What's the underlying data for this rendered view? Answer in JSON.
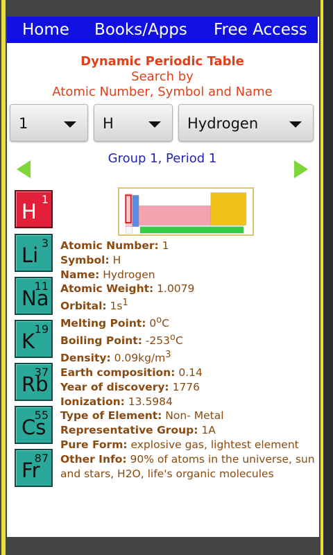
{
  "nav": {
    "home": "Home",
    "books": "Books/Apps",
    "free": "Free Access"
  },
  "header": {
    "title": "Dynamic Periodic Table",
    "line2": "Search by",
    "line3": "Atomic Number, Symbol and Name"
  },
  "selectors": {
    "number": "1",
    "symbol": "H",
    "name": "Hydrogen"
  },
  "group_period": "Group 1, Period 1",
  "tiles": [
    {
      "symbol": "H",
      "number": "1",
      "selected": true
    },
    {
      "symbol": "Li",
      "number": "3"
    },
    {
      "symbol": "Na",
      "number": "11"
    },
    {
      "symbol": "K",
      "number": "19"
    },
    {
      "symbol": "Rb",
      "number": "37"
    },
    {
      "symbol": "Cs",
      "number": "55"
    },
    {
      "symbol": "Fr",
      "number": "87"
    }
  ],
  "details": {
    "atomic_number": {
      "label": "Atomic Number:",
      "value": "1"
    },
    "symbol": {
      "label": "Symbol:",
      "value": "H"
    },
    "name": {
      "label": "Name:",
      "value": "Hydrogen"
    },
    "weight": {
      "label": "Atomic Weight:",
      "value": "1.0079"
    },
    "orbital": {
      "label": "Orbital:",
      "value": "1s",
      "sup": "1"
    },
    "melting": {
      "label": "Melting Point:",
      "value": "0",
      "sup": "o",
      "unit": "C"
    },
    "boiling": {
      "label": "Boiling Point:",
      "value": "-253",
      "sup": "o",
      "unit": "C"
    },
    "density": {
      "label": "Density:",
      "value": "0.09kg/m",
      "sup": "3"
    },
    "earth": {
      "label": "Earth composition:",
      "value": "0.14"
    },
    "year": {
      "label": "Year of discovery:",
      "value": "1776"
    },
    "ionization": {
      "label": "Ionization:",
      "value": "13.5984"
    },
    "type": {
      "label": "Type of Element:",
      "value": "Non- Metal"
    },
    "rep_group": {
      "label": "Representative Group:",
      "value": "1A"
    },
    "pure": {
      "label": "Pure Form:",
      "value": "explosive gas, lightest element"
    },
    "other": {
      "label": "Other Info:",
      "value": "90% of atoms in the universe, sun and stars, H2O, life's organic molecules"
    }
  },
  "colors": {
    "nav_bg": "#1010e0",
    "header_text": "#e0401a",
    "group_text": "#2323b0",
    "info_text": "#8a4a10",
    "tile_teal": "#2aa99a",
    "tile_red": "#e3203a",
    "arrow": "#7dd63a"
  }
}
